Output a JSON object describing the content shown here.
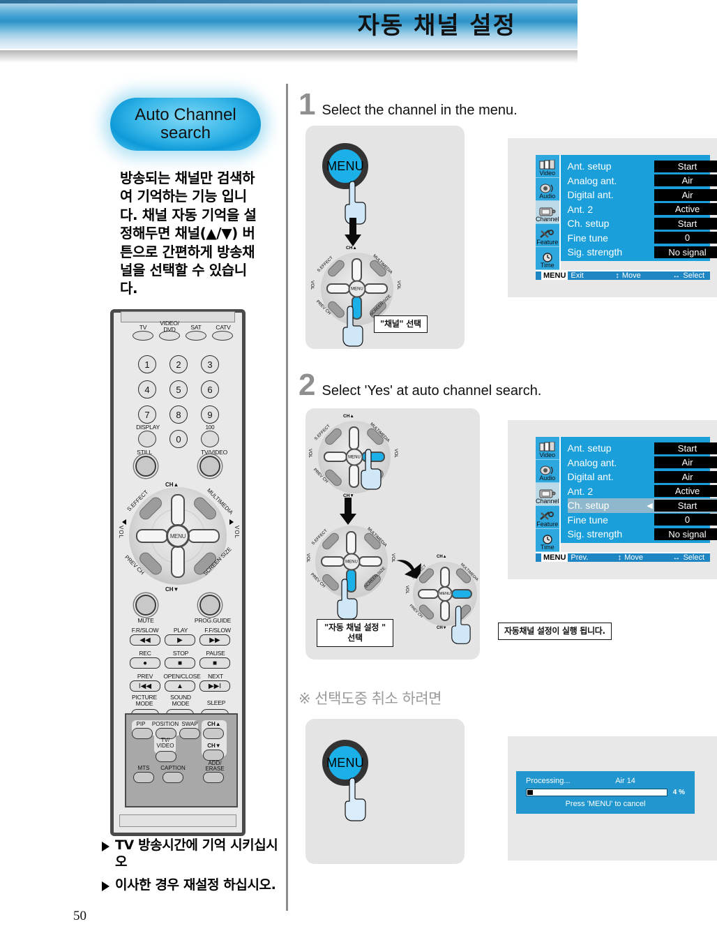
{
  "header": {
    "title": "자동 채널 설정"
  },
  "sidebar": {
    "pill_line1": "Auto Channel",
    "pill_line2": "search",
    "description": "방송되는 채널만 검색하여 기억하는 기능 입니다. 채널 자동 기억을 설정해두면 채널(▲/▼) 버튼으로 간편하게 방송채널을 선택할 수 있습니다.",
    "bullets": [
      "TV 방송시간에 기억 시키십시오",
      "이사한 경우 재설정 하십시오."
    ]
  },
  "remote": {
    "source_buttons": [
      "TV",
      "VIDEO/\nDVD",
      "SAT",
      "CATV"
    ],
    "numbers": [
      "1",
      "2",
      "3",
      "4",
      "5",
      "6",
      "7",
      "8",
      "9",
      "0"
    ],
    "display_label": "DISPLAY",
    "hundred_label": "100",
    "still_label": "STILL",
    "tv_video_label": "TV/VIDEO",
    "nav": {
      "up": "CH▲",
      "down": "CH▼",
      "left": "VOL",
      "right": "VOL",
      "center": "MENU",
      "corner_tl": "S.EFFECT",
      "corner_tr": "MULTIMEDIA",
      "corner_bl": "PREV CH",
      "corner_br": "SCREEN SIZE"
    },
    "mute_label": "MUTE",
    "prog_guide_label": "PROG.GUIDE",
    "transport": [
      {
        "label": "F.R/SLOW",
        "glyph": "◀◀"
      },
      {
        "label": "PLAY",
        "glyph": "▶"
      },
      {
        "label": "F.F/SLOW",
        "glyph": "▶▶"
      },
      {
        "label": "REC",
        "glyph": "●"
      },
      {
        "label": "STOP",
        "glyph": "■"
      },
      {
        "label": "PAUSE",
        "glyph": "■"
      },
      {
        "label": "PREV",
        "glyph": "I◀◀"
      },
      {
        "label": "OPEN/CLOSE",
        "glyph": "▲"
      },
      {
        "label": "NEXT",
        "glyph": "▶▶I"
      }
    ],
    "mode_buttons": [
      "PICTURE\nMODE",
      "SOUND\nMODE",
      "SLEEP"
    ],
    "pip": {
      "pip": "PIP",
      "position": "POSITION",
      "swap": "SWAP",
      "ch_up": "CH▲",
      "tv_video": "TV/\nVIDEO",
      "ch_down": "CH▼",
      "mts": "MTS",
      "caption": "CAPTION",
      "add_erase": "ADD/\nERASE"
    }
  },
  "steps": [
    {
      "num": "1",
      "text": "Select the channel in the menu."
    },
    {
      "num": "2",
      "text": "Select 'Yes' at auto channel search."
    }
  ],
  "illustrations": {
    "menu_button_label": "MENU",
    "step1_callout": "\"채널\" 선택",
    "step2_callout": "\"자동 채널  설정 \"\n선택",
    "step2_result_callout": "자동채널 설정이 실행 됩니다."
  },
  "osd_tabs": [
    {
      "label": "Video",
      "icon": "video-icon",
      "active": false
    },
    {
      "label": "Audio",
      "icon": "audio-icon",
      "active": false
    },
    {
      "label": "Channel",
      "icon": "channel-icon",
      "active": true
    },
    {
      "label": "Feature",
      "icon": "feature-icon",
      "active": false
    },
    {
      "label": "Time",
      "icon": "clock-icon",
      "active": false
    }
  ],
  "osd1": {
    "rows": [
      {
        "label": "Ant. setup",
        "value": "Start",
        "selected": false
      },
      {
        "label": "Analog ant.",
        "value": "Air",
        "selected": false
      },
      {
        "label": "Digital ant.",
        "value": "Air",
        "selected": false
      },
      {
        "label": "Ant. 2",
        "value": "Active",
        "selected": false
      },
      {
        "label": "Ch. setup",
        "value": "Start",
        "selected": false
      },
      {
        "label": "Fine tune",
        "value": "0",
        "selected": false
      },
      {
        "label": "Sig. strength",
        "value": "No signal",
        "selected": false
      }
    ],
    "footer": {
      "menu_key": "MENU",
      "action": "Exit",
      "move": "Move",
      "select": "Select"
    }
  },
  "osd2": {
    "rows": [
      {
        "label": "Ant. setup",
        "value": "Start",
        "selected": false
      },
      {
        "label": "Analog ant.",
        "value": "Air",
        "selected": false
      },
      {
        "label": "Digital ant.",
        "value": "Air",
        "selected": false
      },
      {
        "label": "Ant. 2",
        "value": "Active",
        "selected": false
      },
      {
        "label": "Ch. setup",
        "value": "Start",
        "selected": true
      },
      {
        "label": "Fine tune",
        "value": "0",
        "selected": false
      },
      {
        "label": "Sig. strength",
        "value": "No signal",
        "selected": false
      }
    ],
    "footer": {
      "menu_key": "MENU",
      "action": "Prev.",
      "move": "Move",
      "select": "Select"
    }
  },
  "cancel_section": {
    "heading": "※ 선택도중 취소 하려면",
    "progress": {
      "status": "Processing...",
      "channel": "Air  14",
      "percent_label": "4 %",
      "percent_value": 4,
      "cancel_hint": "Press 'MENU' to cancel"
    }
  },
  "page": {
    "number": "50"
  },
  "colors": {
    "header_blue": "#2e93c8",
    "osd_blue": "#1a9fda",
    "accent_cyan": "#1cb0e8",
    "progress_blue": "#2196cf"
  }
}
